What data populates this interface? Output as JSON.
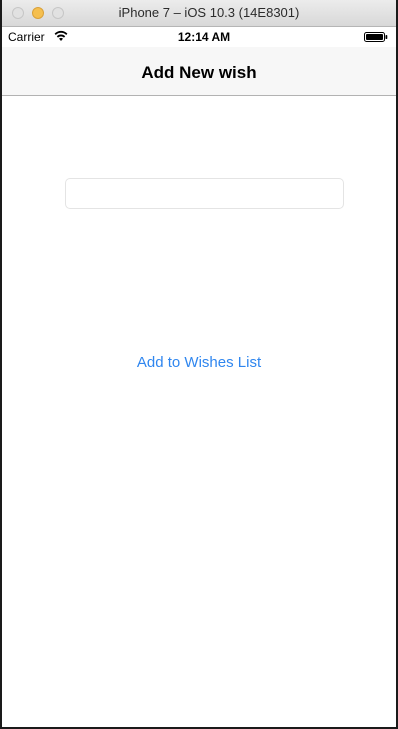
{
  "window": {
    "title": "iPhone 7 – iOS 10.3 (14E8301)"
  },
  "status_bar": {
    "carrier": "Carrier",
    "time": "12:14 AM",
    "icons": [
      "wifi-icon",
      "battery-icon"
    ]
  },
  "nav_bar": {
    "title": "Add New wish"
  },
  "form": {
    "wish_input": {
      "value": "",
      "placeholder": ""
    },
    "add_button_label": "Add to Wishes List"
  },
  "colors": {
    "accent": "#2f86ef",
    "nav_background": "#f7f7f7",
    "title_bar_minimize": "#f5bf4f"
  }
}
